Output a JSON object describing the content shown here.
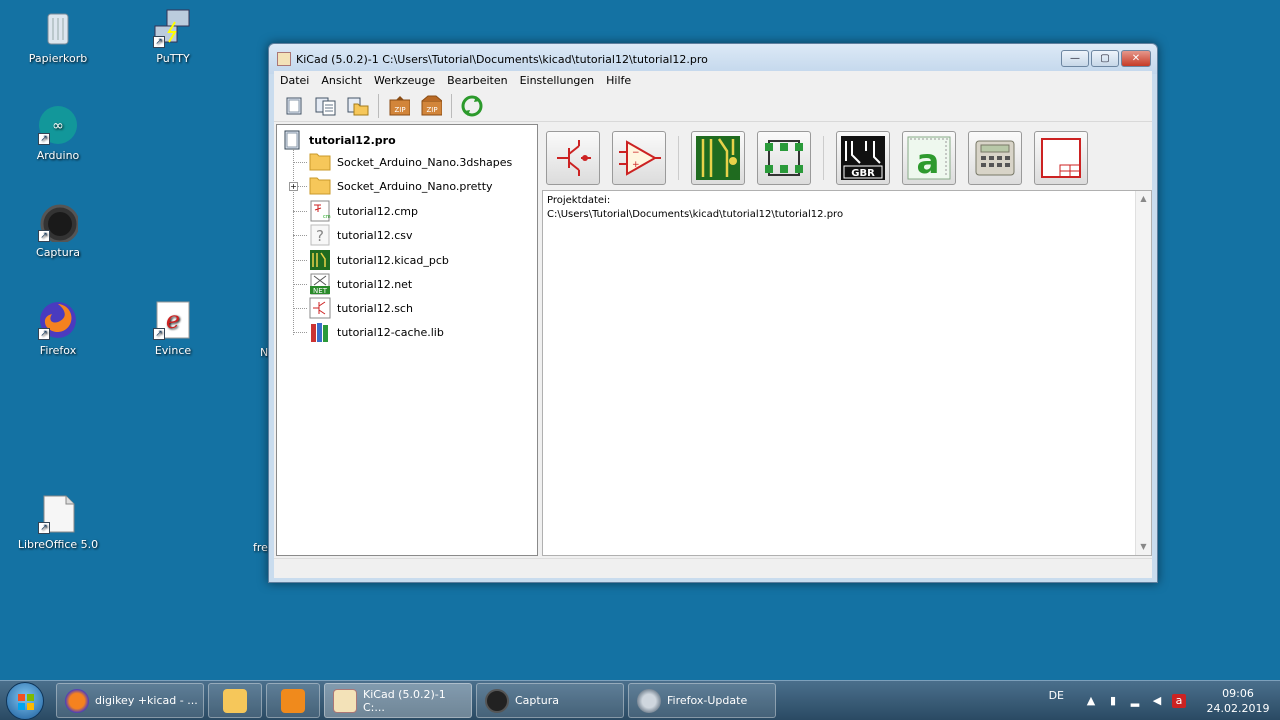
{
  "desktop": {
    "icons": [
      {
        "label": "Papierkorb"
      },
      {
        "label": "PuTTY"
      },
      {
        "label": "Arduino"
      },
      {
        "label": "Captura"
      },
      {
        "label": "Firefox"
      },
      {
        "label": "Evince"
      },
      {
        "label": "LibreOffice 5.0"
      }
    ],
    "edge_labels": [
      "N",
      "fre"
    ]
  },
  "window": {
    "title": "KiCad (5.0.2)-1 C:\\Users\\Tutorial\\Documents\\kicad\\tutorial12\\tutorial12.pro",
    "controls": {
      "minimize": "—",
      "maximize": "▢",
      "close": "✕"
    },
    "menu": [
      "Datei",
      "Ansicht",
      "Werkzeuge",
      "Bearbeiten",
      "Einstellungen",
      "Hilfe"
    ],
    "toolbar_icons": [
      "new-project-icon",
      "new-from-template-icon",
      "open-project-icon",
      "archive-zip-icon",
      "unarchive-zip-icon",
      "refresh-icon"
    ],
    "tree": {
      "root": "tutorial12.pro",
      "items": [
        {
          "label": "Socket_Arduino_Nano.3dshapes",
          "icon": "folder-icon"
        },
        {
          "label": "Socket_Arduino_Nano.pretty",
          "icon": "folder-icon"
        },
        {
          "label": "tutorial12.cmp",
          "icon": "cmp-file-icon"
        },
        {
          "label": "tutorial12.csv",
          "icon": "unknown-file-icon"
        },
        {
          "label": "tutorial12.kicad_pcb",
          "icon": "pcb-file-icon"
        },
        {
          "label": "tutorial12.net",
          "icon": "net-file-icon"
        },
        {
          "label": "tutorial12.sch",
          "icon": "schematic-file-icon"
        },
        {
          "label": "tutorial12-cache.lib",
          "icon": "library-file-icon"
        }
      ]
    },
    "launchers": [
      "schematic-editor-icon",
      "symbol-editor-icon",
      "pcb-editor-icon",
      "footprint-editor-icon",
      "gerber-viewer-icon",
      "bitmap-converter-icon",
      "calculator-icon",
      "page-layout-editor-icon"
    ],
    "messages": {
      "line1": "Projektdatei:",
      "line2": "C:\\Users\\Tutorial\\Documents\\kicad\\tutorial12\\tutorial12.pro"
    }
  },
  "taskbar": {
    "tasks": [
      {
        "label": "digikey +kicad - ..."
      },
      {
        "label": ""
      },
      {
        "label": ""
      },
      {
        "label": "KiCad (5.0.2)-1 C:..."
      },
      {
        "label": "Captura"
      },
      {
        "label": "Firefox-Update"
      }
    ],
    "language": "DE",
    "time": "09:06",
    "date": "24.02.2019"
  },
  "colors": {
    "desktop": "#1472a3",
    "pcb_green": "#1f6b1f",
    "folder": "#f6c75a"
  }
}
